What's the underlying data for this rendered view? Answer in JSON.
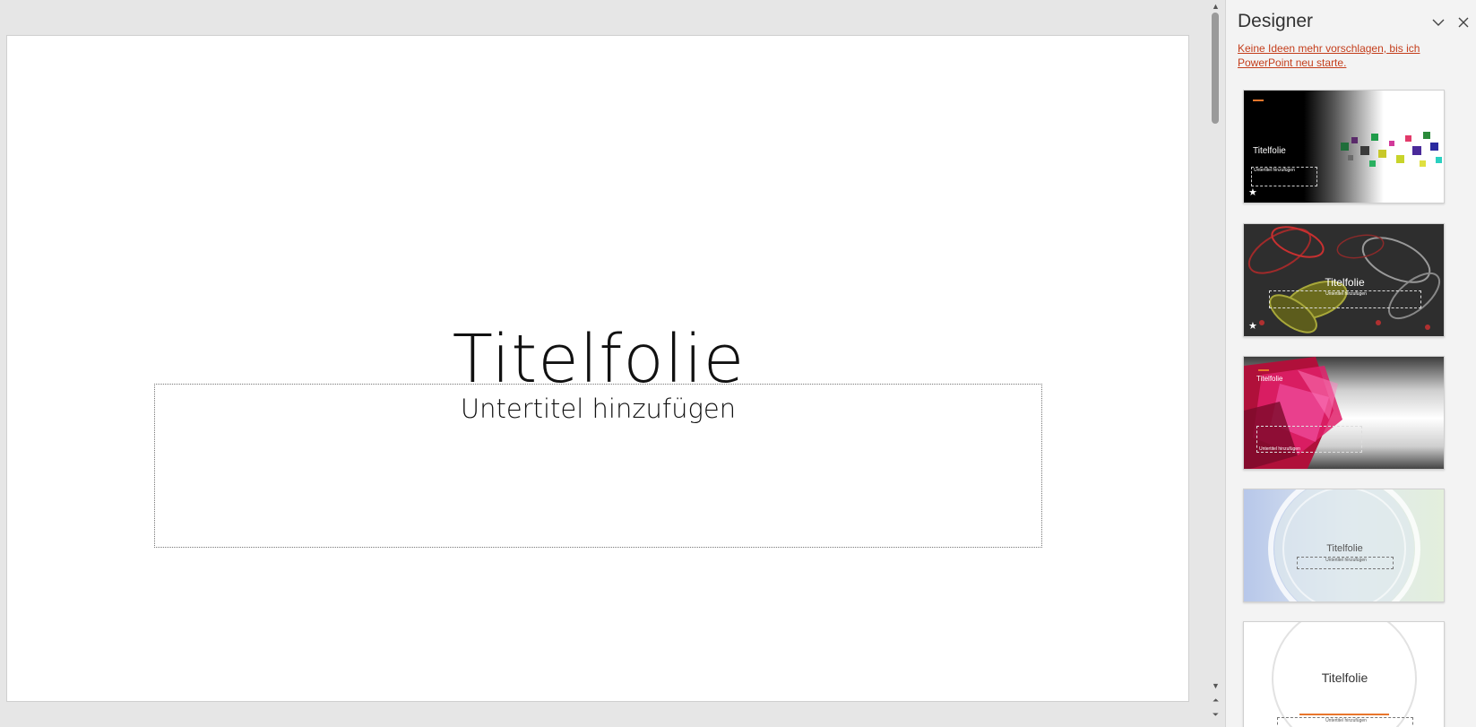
{
  "slide": {
    "title": "Titelfolie",
    "subtitle_placeholder": "Untertitel hinzufügen"
  },
  "designer": {
    "title": "Designer",
    "stop_link": "Keine Ideen mehr vorschlagen, bis ich PowerPoint neu starte.",
    "ideas": [
      {
        "title": "Titelfolie",
        "subtitle": "Untertitel hinzufügen",
        "theme": "dark gradient with colored squares"
      },
      {
        "title": "Titelfolie",
        "subtitle": "Untertitel hinzufügen",
        "theme": "dark flower pattern"
      },
      {
        "title": "Titelfolie",
        "subtitle": "Untertitel hinzufügen",
        "theme": "pink geometric"
      },
      {
        "title": "Titelfolie",
        "subtitle": "Untertitel hinzufügen",
        "theme": "pastel circle"
      },
      {
        "title": "Titelfolie",
        "subtitle": "Untertitel hinzufügen",
        "theme": "white circle outline"
      }
    ]
  },
  "colors": {
    "accent": "#c43e1c",
    "orange_mark": "#e8762c"
  }
}
